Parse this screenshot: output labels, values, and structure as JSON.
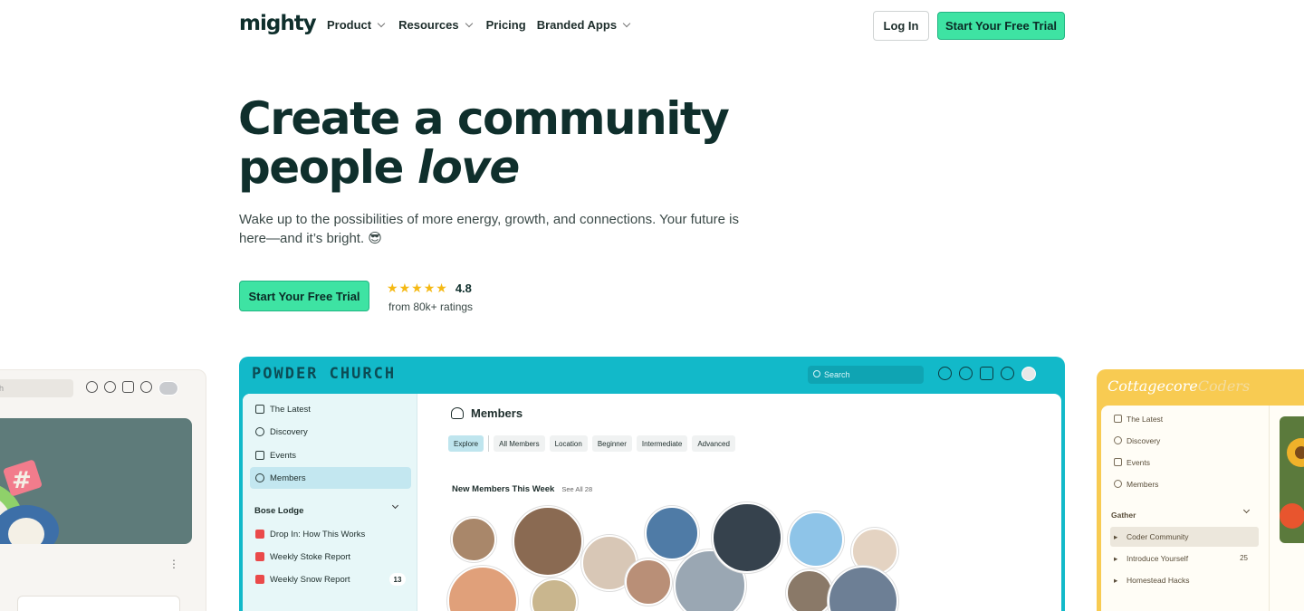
{
  "nav": {
    "logo": "mighty",
    "links": [
      {
        "label": "Product",
        "dropdown": true
      },
      {
        "label": "Resources",
        "dropdown": true
      },
      {
        "label": "Pricing",
        "dropdown": false
      },
      {
        "label": "Branded Apps",
        "dropdown": true
      }
    ],
    "login_label": "Log In",
    "trial_label": "Start Your Free Trial"
  },
  "hero": {
    "title_line1": "Create a community",
    "title_line2a": "people ",
    "title_line2b": "love",
    "subtitle": "Wake up to the possibilities of more energy, growth, and connections. Your future is here—and it’s bright. 😎",
    "cta_label": "Start Your Free Trial",
    "rating_value": "4.8",
    "rating_stars": 5,
    "rating_sub": "from 80k+ ratings"
  },
  "preview_main": {
    "brand": "POWDER CHURCH",
    "search_placeholder": "Search",
    "sidebar_items": [
      {
        "label": "The Latest",
        "icon": "latest-icon"
      },
      {
        "label": "Discovery",
        "icon": "compass-icon"
      },
      {
        "label": "Events",
        "icon": "calendar-icon"
      },
      {
        "label": "Members",
        "icon": "members-icon",
        "active": true
      }
    ],
    "sidebar_group": "Bose Lodge",
    "sidebar_group_items": [
      {
        "label": "Drop In: How This Works",
        "badge": ""
      },
      {
        "label": "Weekly Stoke Report",
        "badge": ""
      },
      {
        "label": "Weekly Snow Report",
        "badge": "13"
      }
    ],
    "page_title": "Members",
    "filters": [
      "Explore",
      "All Members",
      "Location",
      "Beginner",
      "Intermediate",
      "Advanced"
    ],
    "section_title": "New Members This Week",
    "see_all": "See All 28"
  },
  "preview_left": {
    "search_placeholder": "h",
    "menu_icon": "more-vertical-icon"
  },
  "preview_right": {
    "brand_a": "Cottagecore",
    "brand_b": "Coders",
    "sidebar_items": [
      {
        "label": "The Latest"
      },
      {
        "label": "Discovery"
      },
      {
        "label": "Events"
      },
      {
        "label": "Members"
      }
    ],
    "group": "Gather",
    "group_items": [
      {
        "label": "Coder Community",
        "active": true,
        "count": ""
      },
      {
        "label": "Introduce Yourself",
        "active": false,
        "count": "25"
      },
      {
        "label": "Homestead Hacks",
        "active": false,
        "count": ""
      }
    ]
  },
  "colors": {
    "brand_dark": "#0f2f2c",
    "cta_green": "#3ee3a3",
    "powder_teal": "#12b9c9",
    "cottage_yellow": "#f8cb52",
    "star": "#f5b914"
  }
}
